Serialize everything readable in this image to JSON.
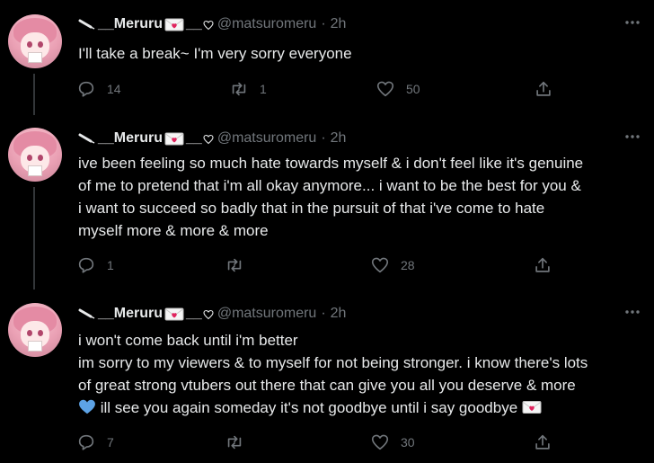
{
  "author": {
    "name": "Meruru",
    "handle": "@matsuromeru"
  },
  "separator": "·",
  "tweets": [
    {
      "time": "2h",
      "lines": [
        "I'll take a break~ I'm very sorry everyone"
      ],
      "replies": "14",
      "retweets": "1",
      "likes": "50"
    },
    {
      "time": "2h",
      "lines": [
        "ive been feeling so much hate towards myself & i don't feel like it's genuine",
        "of me to pretend that i'm all okay anymore... i want to be the best for you &",
        "i want to succeed so badly that in the pursuit of that i've come to hate",
        "myself more & more & more"
      ],
      "replies": "1",
      "retweets": "",
      "likes": "28"
    },
    {
      "time": "2h",
      "lines": [
        "i won't come back until i'm better",
        "im sorry to my viewers & to myself for not being stronger. i know there's lots",
        "of great strong vtubers out there that can give you all you deserve & more",
        "ill see you again someday it's not goodbye until i say goodbye"
      ],
      "replies": "7",
      "retweets": "",
      "likes": "30"
    }
  ],
  "colors": {
    "background": "#000000",
    "text": "#e7e9ea",
    "muted": "#71767b",
    "blue_heart": "#5da3e6",
    "envelope_heart": "#e0245e"
  },
  "icons": [
    "pencil-icon",
    "envelope-heart-icon",
    "heart-outline-icon",
    "more-icon",
    "reply-icon",
    "retweet-icon",
    "like-icon",
    "share-icon",
    "blue-heart-icon"
  ]
}
